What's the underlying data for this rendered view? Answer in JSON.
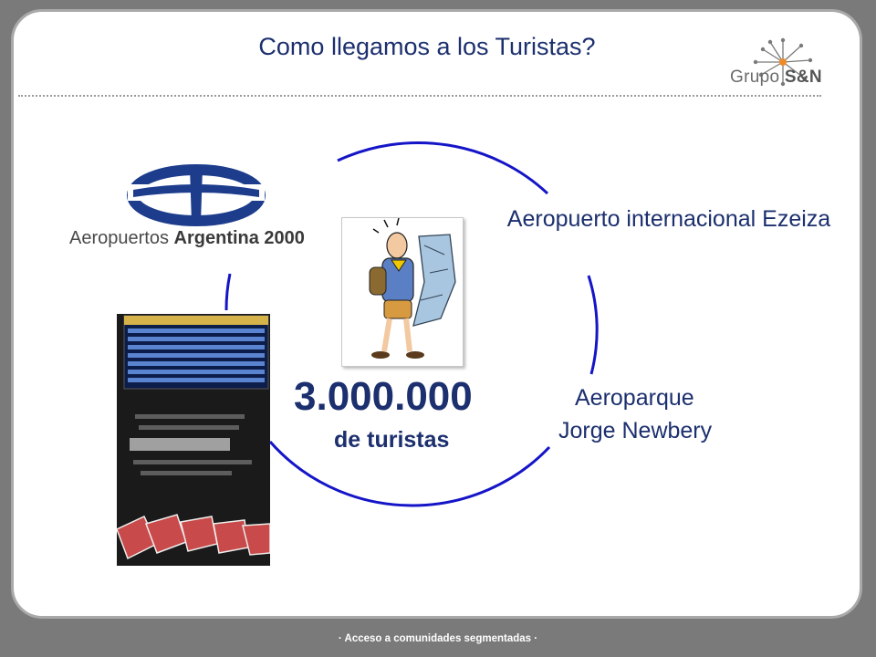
{
  "slide": {
    "title": "Como llegamos a los Turistas?",
    "brand": {
      "prefix": "Grupo",
      "name": "S&N"
    },
    "airports_logo_text": {
      "normal": "Aeropuertos",
      "bold": "Argentina 2000"
    },
    "label_ezeiza": "Aeropuerto internacional Ezeiza",
    "label_aeroparque_line1": "Aeroparque",
    "label_aeroparque_line2": "Jorge Newbery",
    "tourists_count": "3.000.000",
    "tourists_label": "de turistas",
    "footer": "· Acceso  a comunidades segmentadas  ·"
  },
  "colors": {
    "title": "#1c2f6e",
    "circle": "#1515c8",
    "brand_accent": "#f08a28",
    "logo_blue": "#1d3d8c"
  },
  "icons": [
    "network-logo-icon",
    "airport-logo-icon",
    "tourist-illustration",
    "arrivals-board-photo"
  ]
}
